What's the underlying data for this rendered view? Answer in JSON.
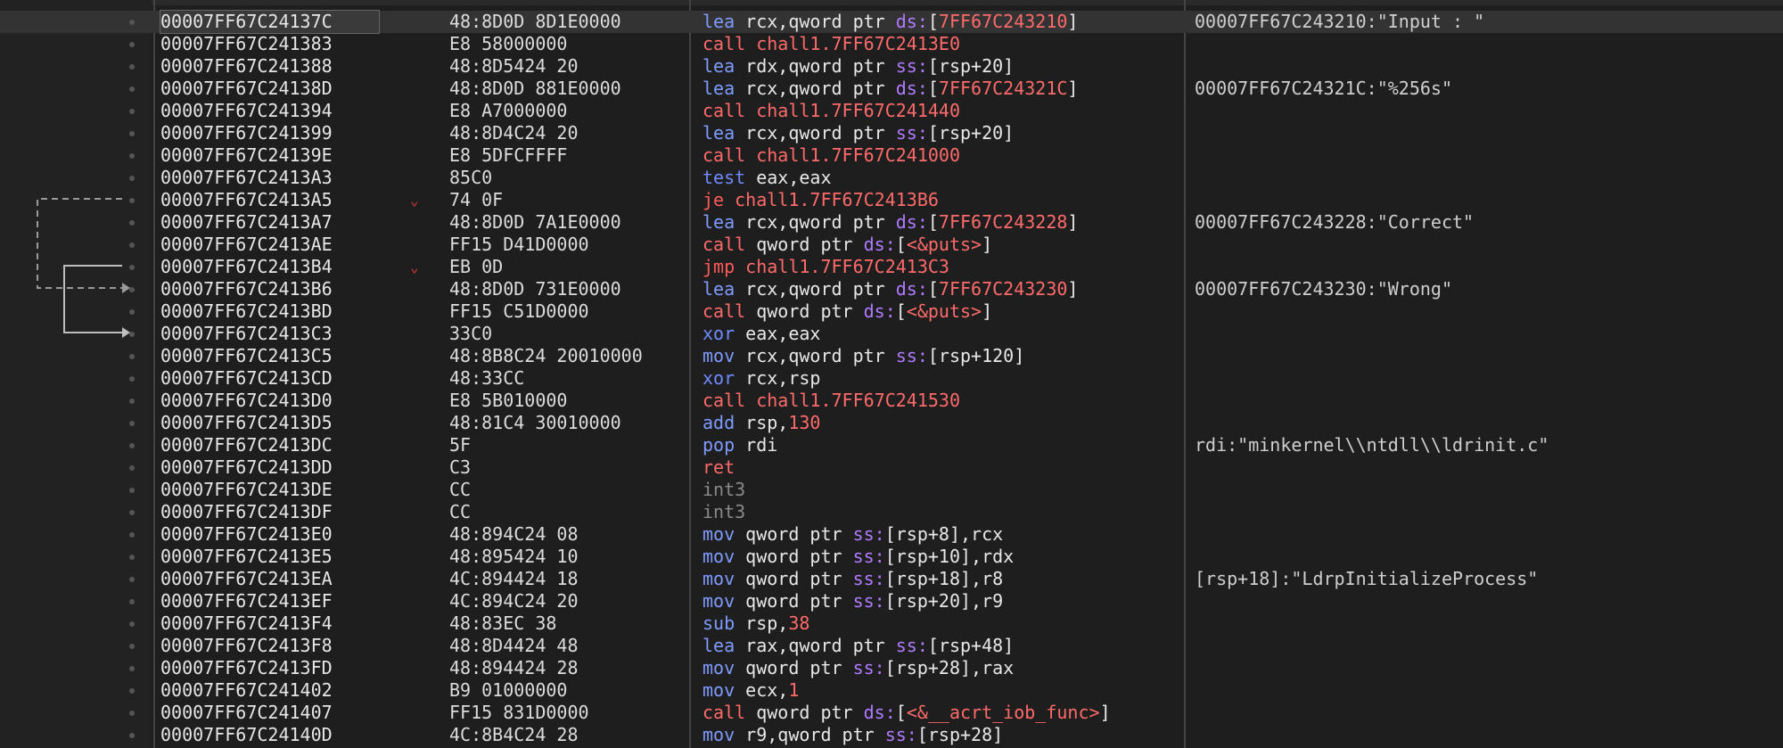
{
  "colors": {
    "background": "#1e1e1e",
    "mnemonic": "#7f9bff",
    "branch": "#ff6a6a",
    "segment": "#b07bff",
    "address_ref": "#ff6a6a",
    "int3": "#8a8a8a",
    "breakpoint_arrow": "#d23b3b"
  },
  "rows": [
    {
      "addr": "00007FF67C24137C",
      "bytes": "48:8D0D 8D1E0000",
      "ins": [
        [
          "m",
          "lea "
        ],
        [
          "reg",
          "rcx,qword ptr "
        ],
        [
          "seg",
          "ds:"
        ],
        [
          "reg",
          "["
        ],
        [
          "addr-ref",
          "7FF67C243210"
        ],
        [
          "reg",
          "]"
        ]
      ],
      "cmt": "00007FF67C243210:\"Input : \"",
      "sel": true
    },
    {
      "addr": "00007FF67C241383",
      "bytes": "E8 58000000",
      "ins": [
        [
          "mc",
          "call "
        ],
        [
          "addr-ref",
          "chall1.7FF67C2413E0"
        ]
      ],
      "cmt": ""
    },
    {
      "addr": "00007FF67C241388",
      "bytes": "48:8D5424 20",
      "ins": [
        [
          "m",
          "lea "
        ],
        [
          "reg",
          "rdx,qword ptr "
        ],
        [
          "seg",
          "ss:"
        ],
        [
          "reg",
          "[rsp+20]"
        ]
      ],
      "cmt": ""
    },
    {
      "addr": "00007FF67C24138D",
      "bytes": "48:8D0D 881E0000",
      "ins": [
        [
          "m",
          "lea "
        ],
        [
          "reg",
          "rcx,qword ptr "
        ],
        [
          "seg",
          "ds:"
        ],
        [
          "reg",
          "["
        ],
        [
          "addr-ref",
          "7FF67C24321C"
        ],
        [
          "reg",
          "]"
        ]
      ],
      "cmt": "00007FF67C24321C:\"%256s\""
    },
    {
      "addr": "00007FF67C241394",
      "bytes": "E8 A7000000",
      "ins": [
        [
          "mc",
          "call "
        ],
        [
          "addr-ref",
          "chall1.7FF67C241440"
        ]
      ],
      "cmt": ""
    },
    {
      "addr": "00007FF67C241399",
      "bytes": "48:8D4C24 20",
      "ins": [
        [
          "m",
          "lea "
        ],
        [
          "reg",
          "rcx,qword ptr "
        ],
        [
          "seg",
          "ss:"
        ],
        [
          "reg",
          "[rsp+20]"
        ]
      ],
      "cmt": ""
    },
    {
      "addr": "00007FF67C24139E",
      "bytes": "E8 5DFCFFFF",
      "ins": [
        [
          "mc",
          "call "
        ],
        [
          "addr-ref",
          "chall1.7FF67C241000"
        ]
      ],
      "cmt": ""
    },
    {
      "addr": "00007FF67C2413A3",
      "bytes": "85C0",
      "ins": [
        [
          "mt",
          "test "
        ],
        [
          "reg",
          "eax,eax"
        ]
      ],
      "cmt": ""
    },
    {
      "addr": "00007FF67C2413A5",
      "bytes": "74 0F",
      "ins": [
        [
          "mj",
          "je "
        ],
        [
          "addr-ref",
          "chall1.7FF67C2413B6"
        ]
      ],
      "cmt": "",
      "arrow": "v"
    },
    {
      "addr": "00007FF67C2413A7",
      "bytes": "48:8D0D 7A1E0000",
      "ins": [
        [
          "m",
          "lea "
        ],
        [
          "reg",
          "rcx,qword ptr "
        ],
        [
          "seg",
          "ds:"
        ],
        [
          "reg",
          "["
        ],
        [
          "addr-ref",
          "7FF67C243228"
        ],
        [
          "reg",
          "]"
        ]
      ],
      "cmt": "00007FF67C243228:\"Correct\""
    },
    {
      "addr": "00007FF67C2413AE",
      "bytes": "FF15 D41D0000",
      "ins": [
        [
          "mc",
          "call "
        ],
        [
          "reg",
          "qword ptr "
        ],
        [
          "seg",
          "ds:"
        ],
        [
          "reg",
          "["
        ],
        [
          "addr-ref",
          "<&puts>"
        ],
        [
          "reg",
          "]"
        ]
      ],
      "cmt": ""
    },
    {
      "addr": "00007FF67C2413B4",
      "bytes": "EB 0D",
      "ins": [
        [
          "mj",
          "jmp "
        ],
        [
          "addr-ref",
          "chall1.7FF67C2413C3"
        ]
      ],
      "cmt": "",
      "arrow": "v"
    },
    {
      "addr": "00007FF67C2413B6",
      "bytes": "48:8D0D 731E0000",
      "ins": [
        [
          "m",
          "lea "
        ],
        [
          "reg",
          "rcx,qword ptr "
        ],
        [
          "seg",
          "ds:"
        ],
        [
          "reg",
          "["
        ],
        [
          "addr-ref",
          "7FF67C243230"
        ],
        [
          "reg",
          "]"
        ]
      ],
      "cmt": "00007FF67C243230:\"Wrong\""
    },
    {
      "addr": "00007FF67C2413BD",
      "bytes": "FF15 C51D0000",
      "ins": [
        [
          "mc",
          "call "
        ],
        [
          "reg",
          "qword ptr "
        ],
        [
          "seg",
          "ds:"
        ],
        [
          "reg",
          "["
        ],
        [
          "addr-ref",
          "<&puts>"
        ],
        [
          "reg",
          "]"
        ]
      ],
      "cmt": ""
    },
    {
      "addr": "00007FF67C2413C3",
      "bytes": "33C0",
      "ins": [
        [
          "mt",
          "xor "
        ],
        [
          "reg",
          "eax,eax"
        ]
      ],
      "cmt": ""
    },
    {
      "addr": "00007FF67C2413C5",
      "bytes": "48:8B8C24 20010000",
      "ins": [
        [
          "m",
          "mov "
        ],
        [
          "reg",
          "rcx,qword ptr "
        ],
        [
          "seg",
          "ss:"
        ],
        [
          "reg",
          "[rsp+120]"
        ]
      ],
      "cmt": ""
    },
    {
      "addr": "00007FF67C2413CD",
      "bytes": "48:33CC",
      "ins": [
        [
          "mt",
          "xor "
        ],
        [
          "reg",
          "rcx,rsp"
        ]
      ],
      "cmt": ""
    },
    {
      "addr": "00007FF67C2413D0",
      "bytes": "E8 5B010000",
      "ins": [
        [
          "mc",
          "call "
        ],
        [
          "addr-ref",
          "chall1.7FF67C241530"
        ]
      ],
      "cmt": ""
    },
    {
      "addr": "00007FF67C2413D5",
      "bytes": "48:81C4 30010000",
      "ins": [
        [
          "m",
          "add "
        ],
        [
          "reg",
          "rsp,"
        ],
        [
          "addr-ref",
          "130"
        ]
      ],
      "cmt": ""
    },
    {
      "addr": "00007FF67C2413DC",
      "bytes": "5F",
      "ins": [
        [
          "m",
          "pop "
        ],
        [
          "reg",
          "rdi"
        ]
      ],
      "cmt": "rdi:\"minkernel\\\\ntdll\\\\ldrinit.c\""
    },
    {
      "addr": "00007FF67C2413DD",
      "bytes": "C3",
      "ins": [
        [
          "mc",
          "ret"
        ]
      ],
      "cmt": ""
    },
    {
      "addr": "00007FF67C2413DE",
      "bytes": "CC",
      "ins": [
        [
          "mi",
          "int3"
        ]
      ],
      "cmt": ""
    },
    {
      "addr": "00007FF67C2413DF",
      "bytes": "CC",
      "ins": [
        [
          "mi",
          "int3"
        ]
      ],
      "cmt": ""
    },
    {
      "addr": "00007FF67C2413E0",
      "bytes": "48:894C24 08",
      "ins": [
        [
          "m",
          "mov "
        ],
        [
          "reg",
          "qword ptr "
        ],
        [
          "seg",
          "ss:"
        ],
        [
          "reg",
          "[rsp+8],rcx"
        ]
      ],
      "cmt": ""
    },
    {
      "addr": "00007FF67C2413E5",
      "bytes": "48:895424 10",
      "ins": [
        [
          "m",
          "mov "
        ],
        [
          "reg",
          "qword ptr "
        ],
        [
          "seg",
          "ss:"
        ],
        [
          "reg",
          "[rsp+10],rdx"
        ]
      ],
      "cmt": ""
    },
    {
      "addr": "00007FF67C2413EA",
      "bytes": "4C:894424 18",
      "ins": [
        [
          "m",
          "mov "
        ],
        [
          "reg",
          "qword ptr "
        ],
        [
          "seg",
          "ss:"
        ],
        [
          "reg",
          "[rsp+18],r8"
        ]
      ],
      "cmt": "[rsp+18]:\"LdrpInitializeProcess\""
    },
    {
      "addr": "00007FF67C2413EF",
      "bytes": "4C:894C24 20",
      "ins": [
        [
          "m",
          "mov "
        ],
        [
          "reg",
          "qword ptr "
        ],
        [
          "seg",
          "ss:"
        ],
        [
          "reg",
          "[rsp+20],r9"
        ]
      ],
      "cmt": ""
    },
    {
      "addr": "00007FF67C2413F4",
      "bytes": "48:83EC 38",
      "ins": [
        [
          "m",
          "sub "
        ],
        [
          "reg",
          "rsp,"
        ],
        [
          "addr-ref",
          "38"
        ]
      ],
      "cmt": ""
    },
    {
      "addr": "00007FF67C2413F8",
      "bytes": "48:8D4424 48",
      "ins": [
        [
          "m",
          "lea "
        ],
        [
          "reg",
          "rax,qword ptr "
        ],
        [
          "seg",
          "ss:"
        ],
        [
          "reg",
          "[rsp+48]"
        ]
      ],
      "cmt": ""
    },
    {
      "addr": "00007FF67C2413FD",
      "bytes": "48:894424 28",
      "ins": [
        [
          "m",
          "mov "
        ],
        [
          "reg",
          "qword ptr "
        ],
        [
          "seg",
          "ss:"
        ],
        [
          "reg",
          "[rsp+28],rax"
        ]
      ],
      "cmt": ""
    },
    {
      "addr": "00007FF67C241402",
      "bytes": "B9 01000000",
      "ins": [
        [
          "m",
          "mov "
        ],
        [
          "reg",
          "ecx,"
        ],
        [
          "addr-ref",
          "1"
        ]
      ],
      "cmt": ""
    },
    {
      "addr": "00007FF67C241407",
      "bytes": "FF15 831D0000",
      "ins": [
        [
          "mc",
          "call "
        ],
        [
          "reg",
          "qword ptr "
        ],
        [
          "seg",
          "ds:"
        ],
        [
          "reg",
          "["
        ],
        [
          "addr-ref",
          "<&__acrt_iob_func>"
        ],
        [
          "reg",
          "]"
        ]
      ],
      "cmt": ""
    },
    {
      "addr": "00007FF67C24140D",
      "bytes": "4C:8B4C24 28",
      "ins": [
        [
          "m",
          "mov "
        ],
        [
          "reg",
          "r9,qword ptr "
        ],
        [
          "seg",
          "ss:"
        ],
        [
          "reg",
          "[rsp+28]"
        ]
      ],
      "cmt": ""
    }
  ]
}
